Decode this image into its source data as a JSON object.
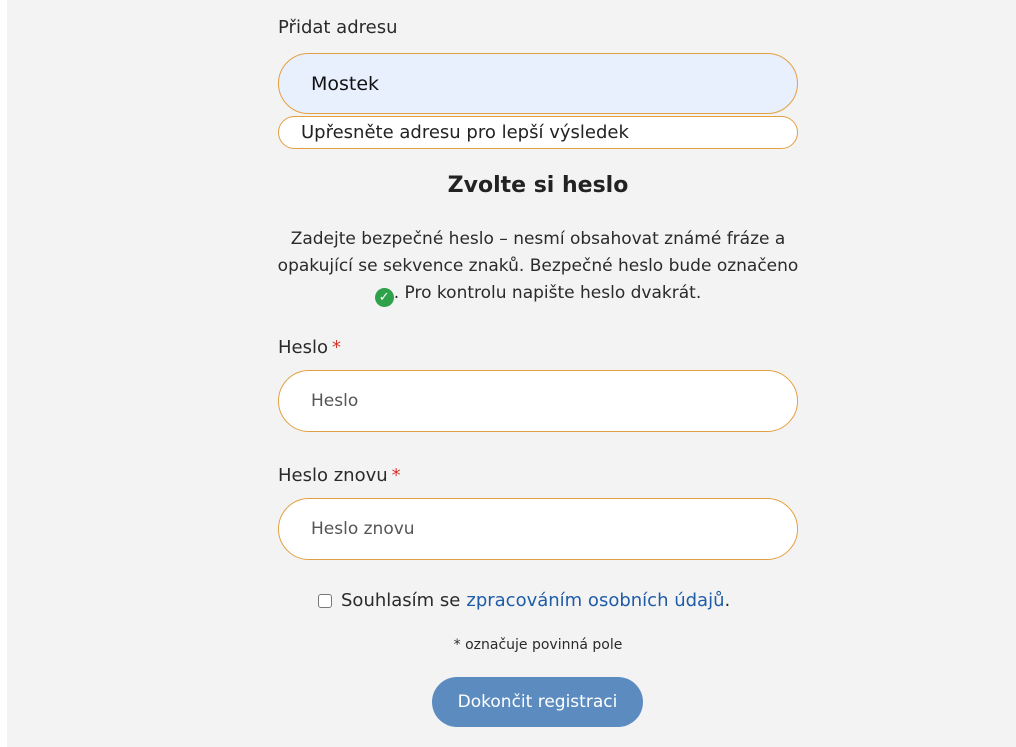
{
  "address": {
    "label": "Přidat adresu",
    "value": "Mostek",
    "hint": "Upřesněte adresu pro lepší výsledek"
  },
  "password_section": {
    "title": "Zvolte si heslo",
    "desc_part1": "Zadejte bezpečné heslo – nesmí obsahovat známé fráze a opakující se sekvence znaků. Bezpečné heslo bude označeno",
    "desc_part2": ". Pro kontrolu napište heslo dvakrát.",
    "check_icon": "check-circle-icon"
  },
  "password": {
    "label": "Heslo",
    "required_mark": "*",
    "placeholder": "Heslo"
  },
  "password_repeat": {
    "label": "Heslo znovu",
    "required_mark": "*",
    "placeholder": "Heslo znovu"
  },
  "consent": {
    "text": "Souhlasím se",
    "link_text": "zpracováním osobních údajů",
    "suffix": ".",
    "checked": false
  },
  "required_note": "* označuje povinná pole",
  "submit_label": "Dokončit registraci",
  "colors": {
    "accent_border": "#e3a040",
    "button": "#5b8bbf",
    "link": "#1f5ca8",
    "required": "#d9342b",
    "success": "#2fa14a"
  }
}
